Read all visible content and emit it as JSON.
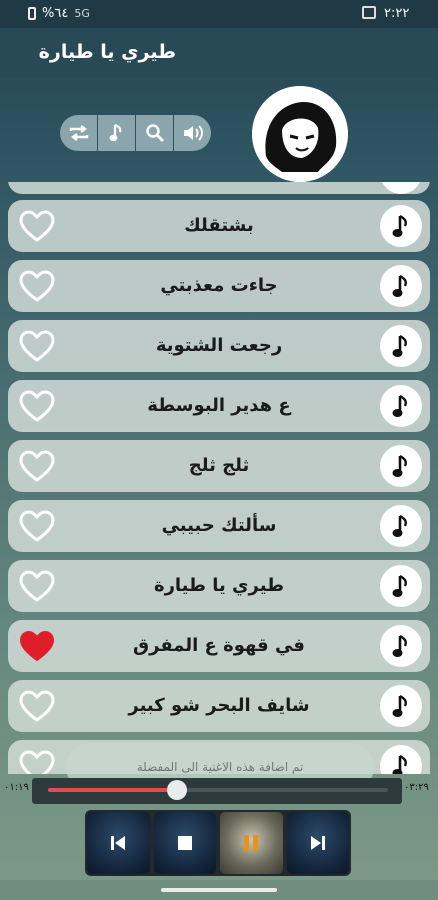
{
  "status_bar": {
    "time": "٢:٢٢",
    "battery": "%٦٤",
    "signal": "5G"
  },
  "header": {
    "title": "طيري يا طيارة"
  },
  "toolbar": {
    "buttons": [
      "repeat-icon",
      "music-note-icon",
      "search-icon",
      "volume-icon"
    ]
  },
  "songs": [
    {
      "title": "بشتقلك",
      "favorite": false
    },
    {
      "title": "جاءت معذبتي",
      "favorite": false
    },
    {
      "title": "رجعت الشتوية",
      "favorite": false
    },
    {
      "title": "ع هدير البوسطة",
      "favorite": false
    },
    {
      "title": "ثلج ثلج",
      "favorite": false
    },
    {
      "title": "سألتك حبيبي",
      "favorite": false
    },
    {
      "title": "طيري يا طيارة",
      "favorite": false
    },
    {
      "title": "في قهوة ع المفرق",
      "favorite": true
    },
    {
      "title": "شايف البحر شو كبير",
      "favorite": false
    }
  ],
  "toast": {
    "text": "تم اضافة هذه الاغنية الى المفضلة"
  },
  "player": {
    "elapsed": "٠١:١٩",
    "total": "٠٣:٢٩",
    "progress": 0.38
  },
  "colors": {
    "heart_on": "#e01e2a",
    "seek_fill": "#e94b4b",
    "row_bg": "#d2dcd7"
  }
}
